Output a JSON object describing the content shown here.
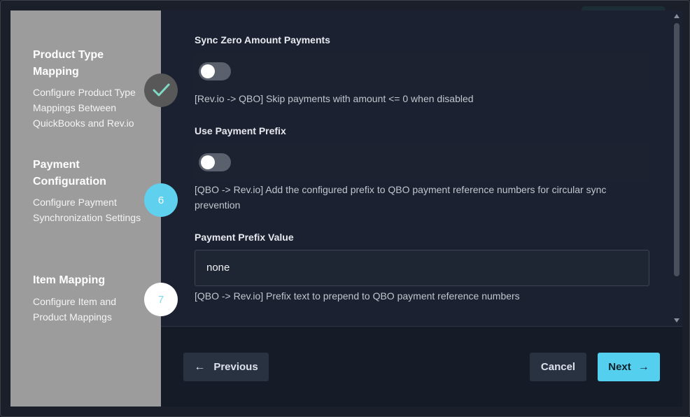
{
  "sidebar": {
    "steps": [
      {
        "title": "Product Type Mapping",
        "description": "Configure Product Type Mappings Between QuickBooks and Rev.io",
        "status": "completed",
        "marker_icon": "check-icon"
      },
      {
        "title": "Payment Configuration",
        "description": "Configure Payment Synchronization Settings",
        "status": "active",
        "marker": "6"
      },
      {
        "title": "Item Mapping",
        "description": "Configure Item and Product Mappings",
        "status": "pending",
        "marker": "7"
      }
    ]
  },
  "form": {
    "sync_zero": {
      "label": "Sync Zero Amount Payments",
      "enabled": false,
      "help": "[Rev.io -> QBO] Skip payments with amount <= 0 when disabled"
    },
    "use_prefix": {
      "label": "Use Payment Prefix",
      "enabled": false,
      "help": "[QBO -> Rev.io] Add the configured prefix to QBO payment reference numbers for circular sync prevention"
    },
    "prefix_value": {
      "label": "Payment Prefix Value",
      "value": "none",
      "help": "[QBO -> Rev.io] Prefix text to prepend to QBO payment reference numbers"
    }
  },
  "footer": {
    "previous_label": "Previous",
    "cancel_label": "Cancel",
    "next_label": "Next"
  },
  "colors": {
    "accent": "#55cfee",
    "sidebar_bg": "#9c9c9c",
    "content_bg": "#1b2130"
  }
}
